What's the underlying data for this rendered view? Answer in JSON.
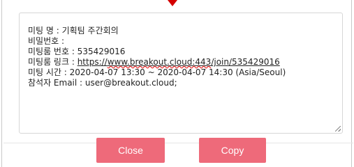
{
  "textarea": {
    "line_name": "미팅 명 : 기획팀 주간회의",
    "line_password": "비밀번호 :",
    "line_room_number": "미팅룸 번호 : 535429016",
    "line_link_prefix": "미팅룸 링크 : ",
    "line_link_url_part1": "https://",
    "line_link_url_part2": "www.breakout.cloud:443",
    "line_link_url_part3": "/join/535429016",
    "line_time": "미팅 시간 : 2020-04-07 13:30 ~ 2020-04-07 14:30 (Asia/Seoul)",
    "line_attendee": "참석자 Email : user@breakout.cloud;"
  },
  "buttons": {
    "close_label": "Close",
    "copy_label": "Copy"
  },
  "colors": {
    "button_bg": "#ee6a7a",
    "pointer": "#d40000"
  },
  "icons": {
    "resize_grip": "resize-grip-icon",
    "pointer": "caret-down-icon"
  }
}
